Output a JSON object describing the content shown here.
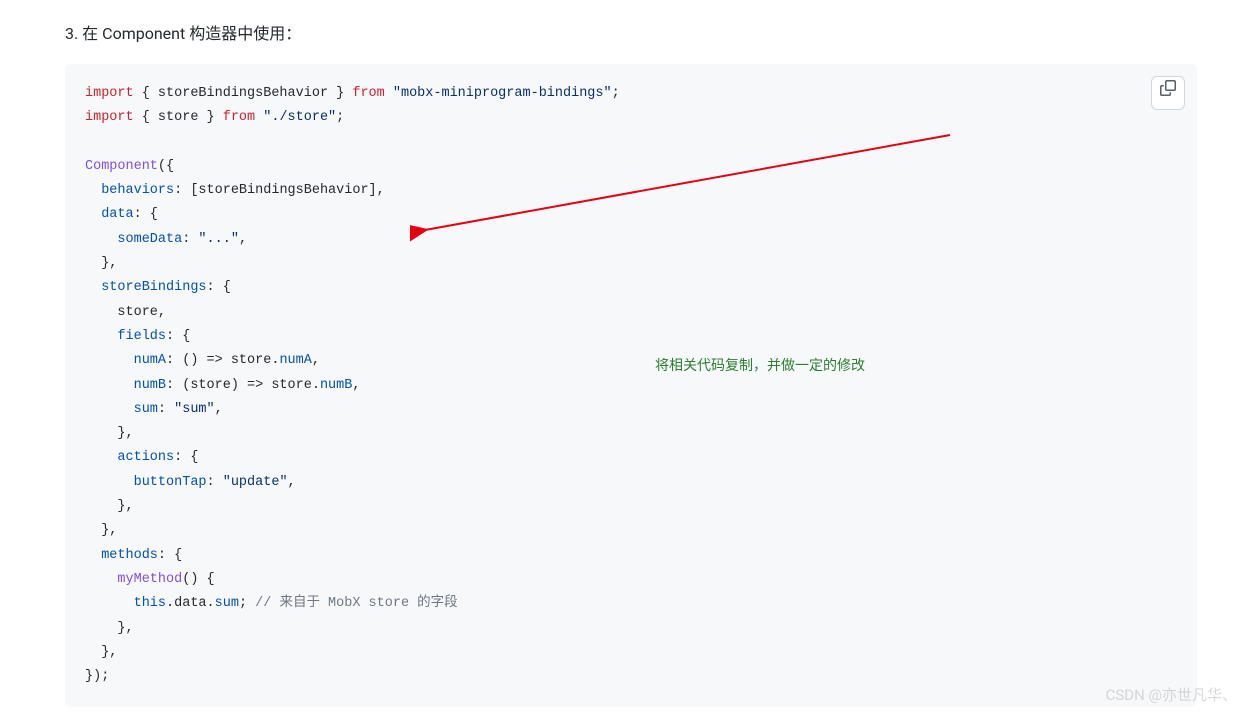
{
  "heading": "3. 在 Component 构造器中使用：",
  "code": {
    "l1_import": "import",
    "l1_braces1": " { storeBindingsBehavior } ",
    "l1_from": "from",
    "l1_str": " \"mobx-miniprogram-bindings\"",
    "l1_end": ";",
    "l2_import": "import",
    "l2_braces": " { store } ",
    "l2_from": "from",
    "l2_str": " \"./store\"",
    "l2_end": ";",
    "l4_fn": "Component",
    "l4_paren": "({",
    "l5_key": "  behaviors",
    "l5_val": ": [storeBindingsBehavior],",
    "l6_key": "  data",
    "l6_val": ": {",
    "l7_key": "    someData",
    "l7_colon": ": ",
    "l7_str": "\"...\"",
    "l7_end": ",",
    "l8": "  },",
    "l9_key": "  storeBindings",
    "l9_val": ": {",
    "l10": "    store,",
    "l11_key": "    fields",
    "l11_val": ": {",
    "l12_key": "      numA",
    "l12_mid": ": () => store.",
    "l12_prop": "numA",
    "l12_end": ",",
    "l13_key": "      numB",
    "l13_mid": ": (store) => store.",
    "l13_prop": "numB",
    "l13_end": ",",
    "l14_key": "      sum",
    "l14_colon": ": ",
    "l14_str": "\"sum\"",
    "l14_end": ",",
    "l15": "    },",
    "l16_key": "    actions",
    "l16_val": ": {",
    "l17_key": "      buttonTap",
    "l17_colon": ": ",
    "l17_str": "\"update\"",
    "l17_end": ",",
    "l18": "    },",
    "l19": "  },",
    "l20_key": "  methods",
    "l20_val": ": {",
    "l21_fn": "    myMethod",
    "l21_paren": "() {",
    "l22_this": "      this",
    "l22_data": ".data.",
    "l22_sum": "sum",
    "l22_semi": "; ",
    "l22_cmt": "// 来自于 MobX store 的字段",
    "l23": "    },",
    "l24": "  },",
    "l25": "});"
  },
  "annotation": "将相关代码复制，并做一定的修改",
  "watermark": "CSDN @亦世凡华、"
}
